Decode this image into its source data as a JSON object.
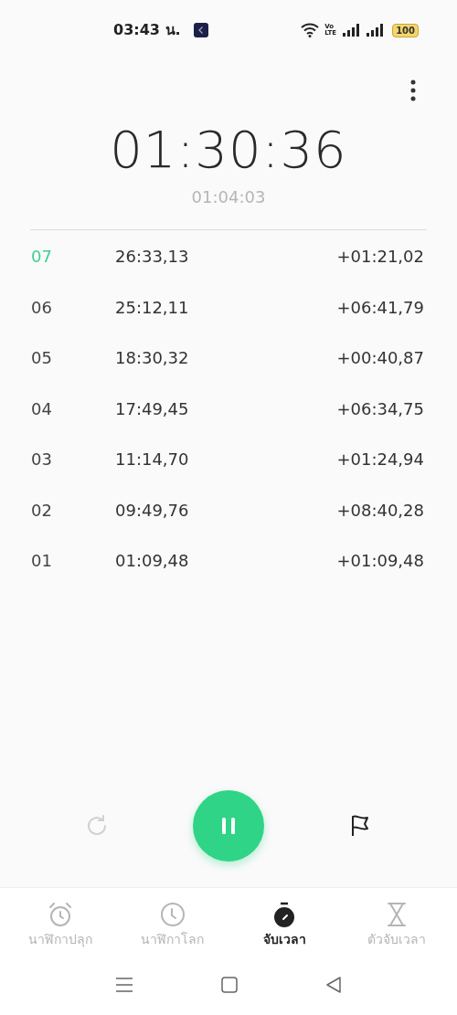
{
  "status_bar": {
    "time": "03:43 น.",
    "volte": "Vo LTE",
    "battery": "100"
  },
  "stopwatch": {
    "main_time": "01:30:36",
    "lap_time": "01:04:03"
  },
  "laps": [
    {
      "number": "07",
      "total": "26:33,13",
      "split": "+01:21,02",
      "highlight": true
    },
    {
      "number": "06",
      "total": "25:12,11",
      "split": "+06:41,79",
      "highlight": false
    },
    {
      "number": "05",
      "total": "18:30,32",
      "split": "+00:40,87",
      "highlight": false
    },
    {
      "number": "04",
      "total": "17:49,45",
      "split": "+06:34,75",
      "highlight": false
    },
    {
      "number": "03",
      "total": "11:14,70",
      "split": "+01:24,94",
      "highlight": false
    },
    {
      "number": "02",
      "total": "09:49,76",
      "split": "+08:40,28",
      "highlight": false
    },
    {
      "number": "01",
      "total": "01:09,48",
      "split": "+01:09,48",
      "highlight": false
    }
  ],
  "controls": {
    "reset_disabled": true,
    "running": true
  },
  "tabs": [
    {
      "kind": "alarm",
      "label": "นาฬิกาปลุก",
      "selected": false
    },
    {
      "kind": "world",
      "label": "นาฬิกาโลก",
      "selected": false
    },
    {
      "kind": "stopwatch",
      "label": "จับเวลา",
      "selected": true
    },
    {
      "kind": "timer",
      "label": "ตัวจับเวลา",
      "selected": false
    }
  ]
}
